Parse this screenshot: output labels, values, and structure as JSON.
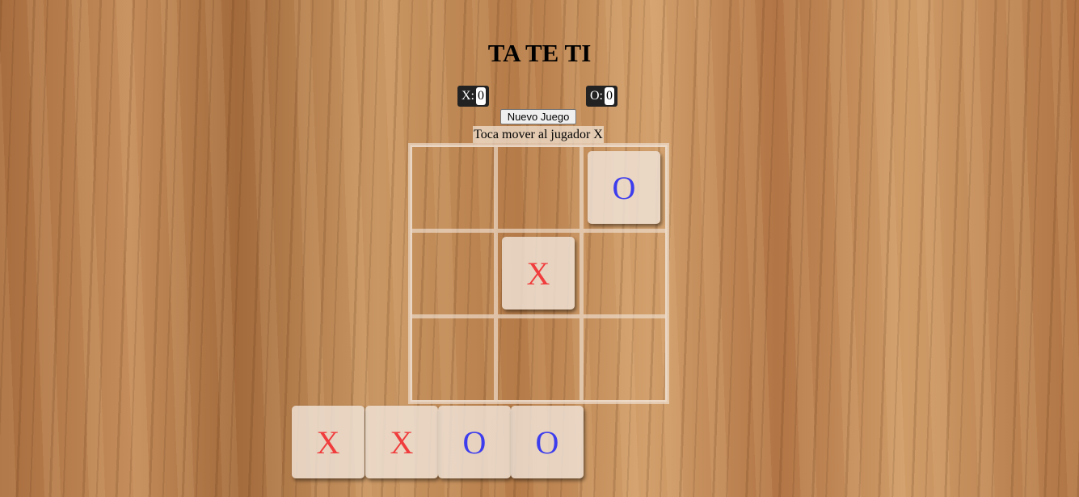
{
  "title": "TA TE TI",
  "scores": {
    "x_label": "X:",
    "x_value": "0",
    "o_label": "O:",
    "o_value": "0"
  },
  "new_game_label": "Nuevo Juego",
  "status": "Toca mover al jugador X",
  "board": [
    "",
    "",
    "O",
    "",
    "X",
    "",
    "",
    "",
    ""
  ],
  "tray": [
    "X",
    "X",
    "O",
    "O"
  ],
  "colors": {
    "x": "#f03c3c",
    "o": "#3d3ded"
  }
}
